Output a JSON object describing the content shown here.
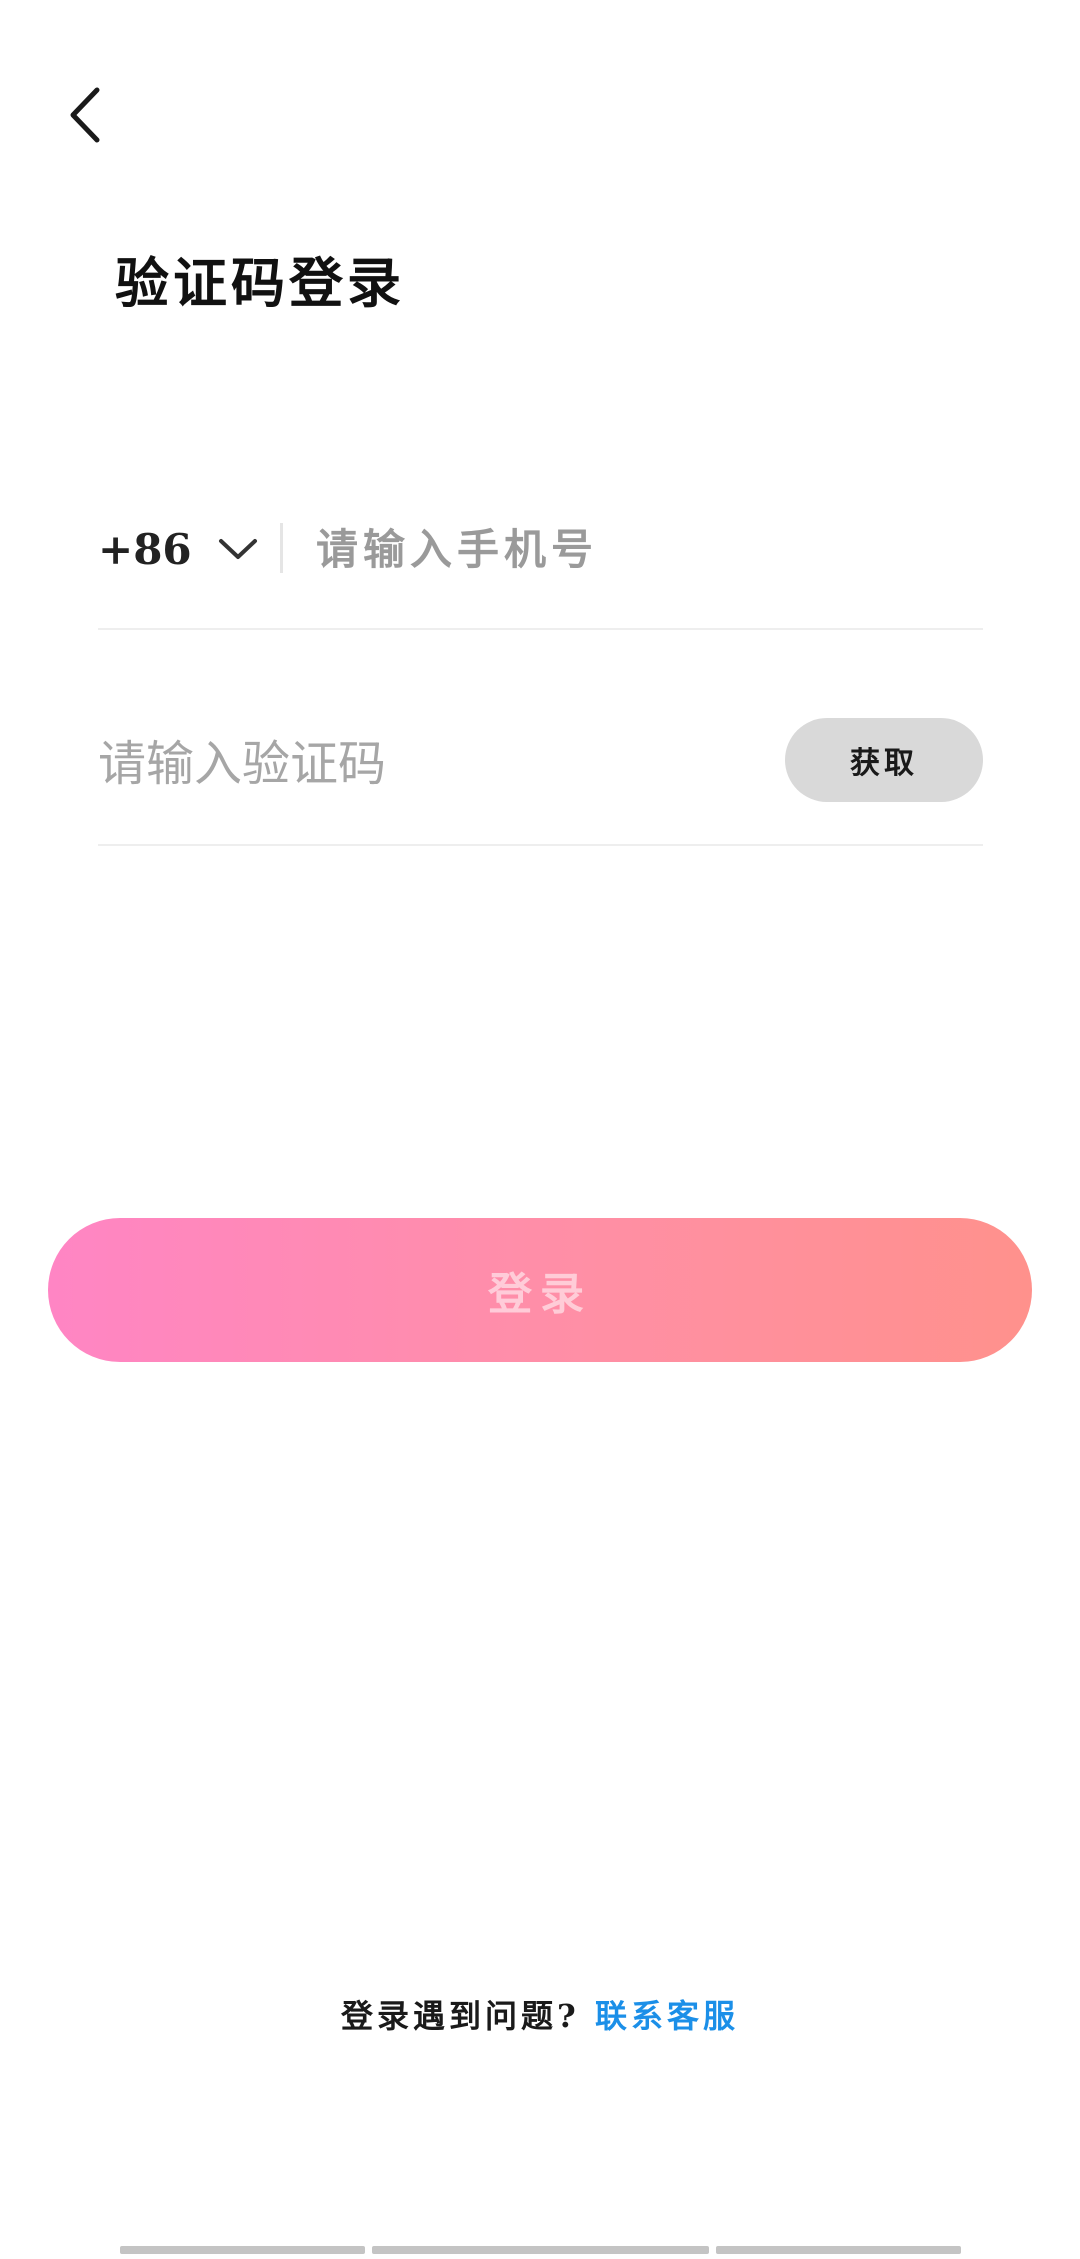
{
  "header": {
    "back_icon": "chevron-left-icon",
    "title": "验证码登录"
  },
  "phone": {
    "country_code": "+86",
    "dropdown_icon": "chevron-down-icon",
    "placeholder": "请输入手机号",
    "value": ""
  },
  "verification": {
    "placeholder": "请输入验证码",
    "value": "",
    "get_code_label": "获取"
  },
  "login": {
    "label": "登录",
    "gradient_start": "#ff85c4",
    "gradient_end": "#ff918c"
  },
  "footer": {
    "help_text": "登录遇到问题?",
    "contact_label": "联系客服",
    "link_color": "#1b8fe8"
  }
}
